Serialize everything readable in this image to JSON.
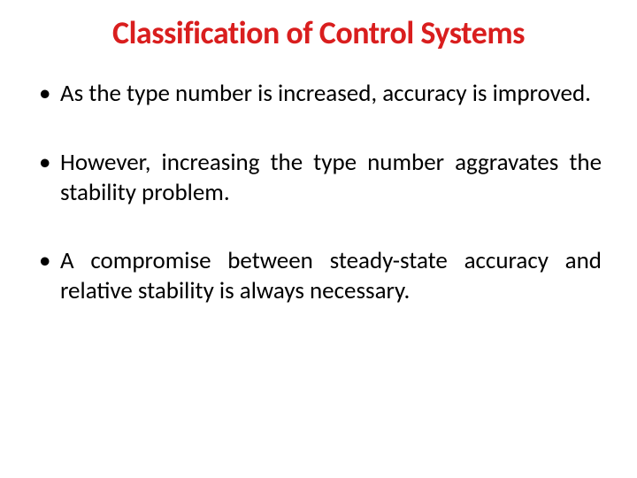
{
  "title": "Classification of Control Systems",
  "bullets": [
    "As the type number is increased, accuracy is improved.",
    "However, increasing the type number aggravates the stability problem.",
    "A compromise between steady-state accuracy and relative stability is always necessary."
  ]
}
